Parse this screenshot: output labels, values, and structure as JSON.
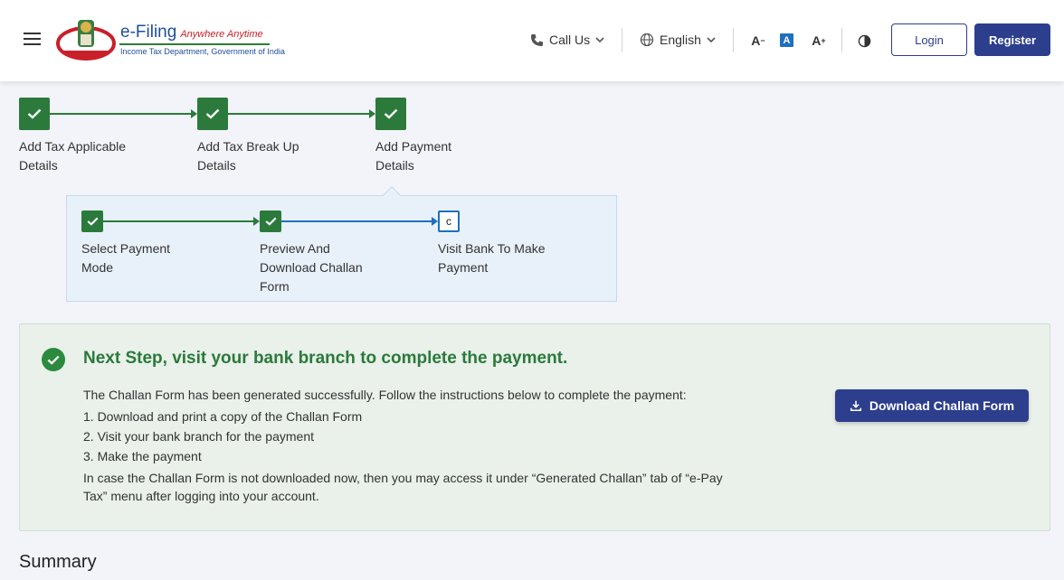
{
  "header": {
    "logo_title": "e-Filing",
    "logo_tagline": "Anywhere Anytime",
    "logo_dept": "Income Tax Department, Government of India",
    "call_us": "Call Us",
    "language": "English",
    "font_decrease": "A",
    "font_default": "A",
    "font_increase": "A",
    "login": "Login",
    "register": "Register"
  },
  "steps": [
    {
      "line1": "Add Tax Applicable",
      "line2": "Details",
      "status": "done"
    },
    {
      "line1": "Add Tax Break Up",
      "line2": "Details",
      "status": "done"
    },
    {
      "line1": "Add Payment",
      "line2": "Details",
      "status": "done"
    }
  ],
  "substeps": [
    {
      "line1": "Select Payment",
      "line2": "Mode",
      "line3": "",
      "status": "done"
    },
    {
      "line1": "Preview And",
      "line2": "Download Challan",
      "line3": "Form",
      "status": "done"
    },
    {
      "line1": "Visit Bank To Make",
      "line2": "Payment",
      "line3": "",
      "status": "current",
      "marker": "c"
    }
  ],
  "card": {
    "title": "Next Step, visit your bank branch to complete the payment.",
    "intro": "The Challan Form has been generated successfully. Follow the instructions below to complete the payment:",
    "item1": "1. Download and print a copy of the Challan Form",
    "item2": "2. Visit your bank branch for the payment",
    "item3": "3. Make the payment",
    "note1": "In case the Challan Form is not downloaded now, then you may access it under “Generated Challan” tab of “e-Pay",
    "note2": "Tax” menu after logging into your account.",
    "download": "Download Challan Form"
  },
  "summary_heading": "Summary",
  "colors": {
    "primary": "#2c3e8c",
    "success": "#2b7a3b",
    "current_step": "#1f6fbf"
  }
}
